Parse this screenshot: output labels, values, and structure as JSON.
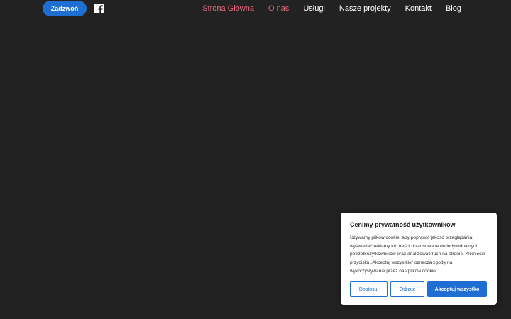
{
  "header": {
    "call_button": "Zadzwoń",
    "social_icon": "facebook-icon",
    "nav": [
      {
        "label": "Strona Główna",
        "active": true
      },
      {
        "label": "O nas",
        "active": true
      },
      {
        "label": "Usługi",
        "active": false
      },
      {
        "label": "Nasze projekty",
        "active": false
      },
      {
        "label": "Kontakt",
        "active": false
      },
      {
        "label": "Blog",
        "active": false
      }
    ]
  },
  "cookie": {
    "title": "Cenimy prywatność użytkowników",
    "text": "Używamy plików cookie, aby poprawić jakość przeglądania, wyświetlać reklamy lub treści dostosowane do indywidualnych potrzeb użytkowników oraz analizować ruch na stronie. Kliknięcie przycisku „Akceptuj wszystkie” oznacza zgodę na wykorzystywanie przez nas plików cookie.",
    "customize": "Dostosuj",
    "reject": "Odrzuć",
    "accept": "Akceptuj wszystko"
  },
  "colors": {
    "background": "#222222",
    "accent_blue": "#1f6ed4",
    "nav_active": "#e8677a"
  }
}
